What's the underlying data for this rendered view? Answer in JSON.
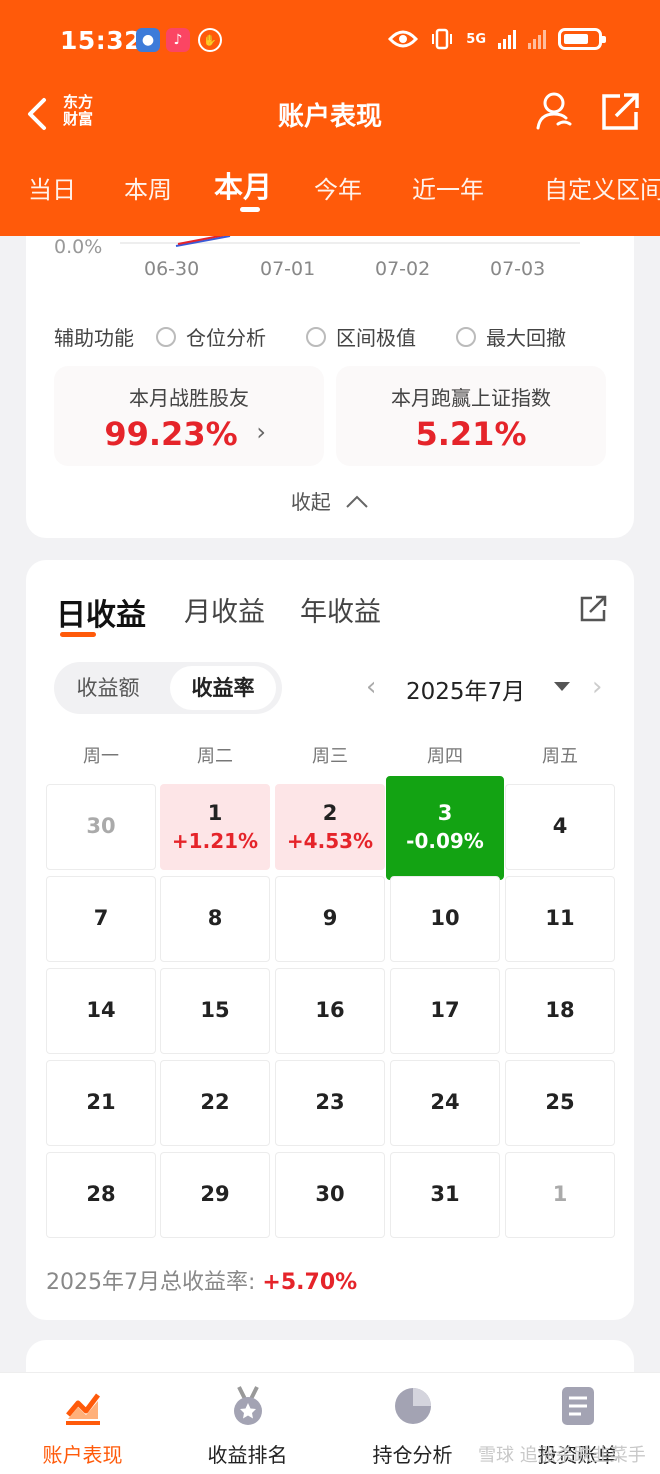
{
  "status": {
    "time": "15:32",
    "network": "5G"
  },
  "header": {
    "logo_line1": "东方",
    "logo_line2": "财富",
    "title": "账户表现",
    "periods": [
      "当日",
      "本周",
      "本月",
      "今年",
      "近一年",
      "自定义区间"
    ],
    "active_period": "本月"
  },
  "chart_area": {
    "y_label": "0.0%",
    "x_ticks": [
      "06-30",
      "07-01",
      "07-02",
      "07-03"
    ]
  },
  "aux": {
    "label": "辅助功能",
    "options": [
      "仓位分析",
      "区间极值",
      "最大回撤"
    ]
  },
  "stats": {
    "beat_friends_label": "本月战胜股友",
    "beat_friends_value": "99.23%",
    "beat_index_label": "本月跑赢上证指数",
    "beat_index_value": "5.21%"
  },
  "collapse_label": "收起",
  "returns": {
    "tabs": [
      "日收益",
      "月收益",
      "年收益"
    ],
    "active_tab": "日收益",
    "segment": [
      "收益额",
      "收益率"
    ],
    "active_segment": "收益率",
    "month": "2025年7月",
    "weekdays": [
      "周一",
      "周二",
      "周三",
      "周四",
      "周五"
    ],
    "weeks": [
      [
        {
          "d": "30",
          "other": true
        },
        {
          "d": "1",
          "p": "+1.21%",
          "t": "up"
        },
        {
          "d": "2",
          "p": "+4.53%",
          "t": "up"
        },
        {
          "d": "3",
          "p": "-0.09%",
          "t": "down"
        },
        {
          "d": "4"
        }
      ],
      [
        {
          "d": "7"
        },
        {
          "d": "8"
        },
        {
          "d": "9"
        },
        {
          "d": "10"
        },
        {
          "d": "11"
        }
      ],
      [
        {
          "d": "14"
        },
        {
          "d": "15"
        },
        {
          "d": "16"
        },
        {
          "d": "17"
        },
        {
          "d": "18"
        }
      ],
      [
        {
          "d": "21"
        },
        {
          "d": "22"
        },
        {
          "d": "23"
        },
        {
          "d": "24"
        },
        {
          "d": "25"
        }
      ],
      [
        {
          "d": "28"
        },
        {
          "d": "29"
        },
        {
          "d": "30"
        },
        {
          "d": "31"
        },
        {
          "d": "1",
          "other": true
        }
      ]
    ],
    "total_label": "2025年7月总收益率:",
    "total_value": "+5.70%"
  },
  "tabbar": {
    "items": [
      "账户表现",
      "收益排名",
      "持仓分析",
      "投资账单"
    ],
    "active": "账户表现",
    "watermark": "雪球  追涨杀跌韭菜手"
  },
  "colors": {
    "brand": "#ff5a0a",
    "up": "#e5242a",
    "down": "#13a313"
  }
}
